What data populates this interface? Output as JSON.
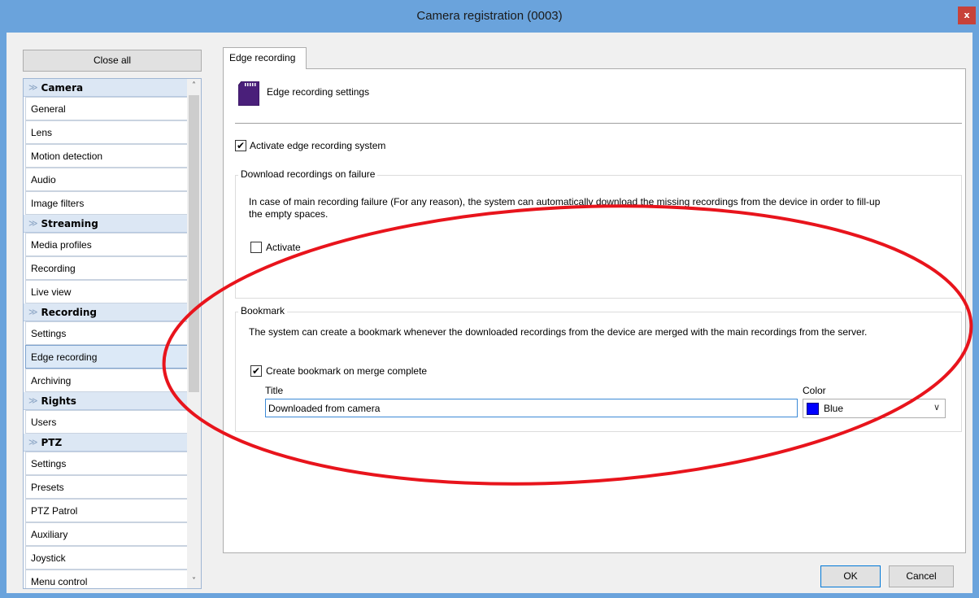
{
  "window": {
    "title": "Camera registration (0003)",
    "close_glyph": "x"
  },
  "sidebar": {
    "close_all_label": "Close all",
    "categories": [
      {
        "label": "Camera",
        "items": [
          "General",
          "Lens",
          "Motion detection",
          "Audio",
          "Image filters"
        ]
      },
      {
        "label": "Streaming",
        "items": [
          "Media profiles",
          "Recording",
          "Live view"
        ]
      },
      {
        "label": "Recording",
        "items": [
          "Settings",
          "Edge recording",
          "Archiving"
        ]
      },
      {
        "label": "Rights",
        "items": [
          "Users"
        ]
      },
      {
        "label": "PTZ",
        "items": [
          "Settings",
          "Presets",
          "PTZ Patrol",
          "Auxiliary",
          "Joystick",
          "Menu control"
        ]
      }
    ],
    "selected_item": "Edge recording"
  },
  "main": {
    "tab_label": "Edge recording",
    "header_title": "Edge recording settings",
    "activate_edge_label": "Activate edge recording system",
    "activate_edge_checked": true,
    "download_group": {
      "legend": "Download recordings on failure",
      "description_line1": "In case of main recording failure (For any reason), the system can automatically download the missing recordings from the device in order to fill-up",
      "description_line2": "the empty spaces.",
      "activate_label": "Activate",
      "activate_checked": false
    },
    "bookmark_group": {
      "legend": "Bookmark",
      "description": "The system can create a bookmark whenever the downloaded recordings from the device are merged with the main recordings from the server.",
      "create_label": "Create bookmark on merge complete",
      "create_checked": true,
      "title_label": "Title",
      "title_value": "Downloaded from camera",
      "color_label": "Color",
      "color_value": "Blue",
      "color_swatch": "#0000ff"
    }
  },
  "footer": {
    "ok_label": "OK",
    "cancel_label": "Cancel"
  },
  "colors": {
    "titlebar": "#6aa3dc",
    "annotation_ellipse": "#e8141c"
  }
}
